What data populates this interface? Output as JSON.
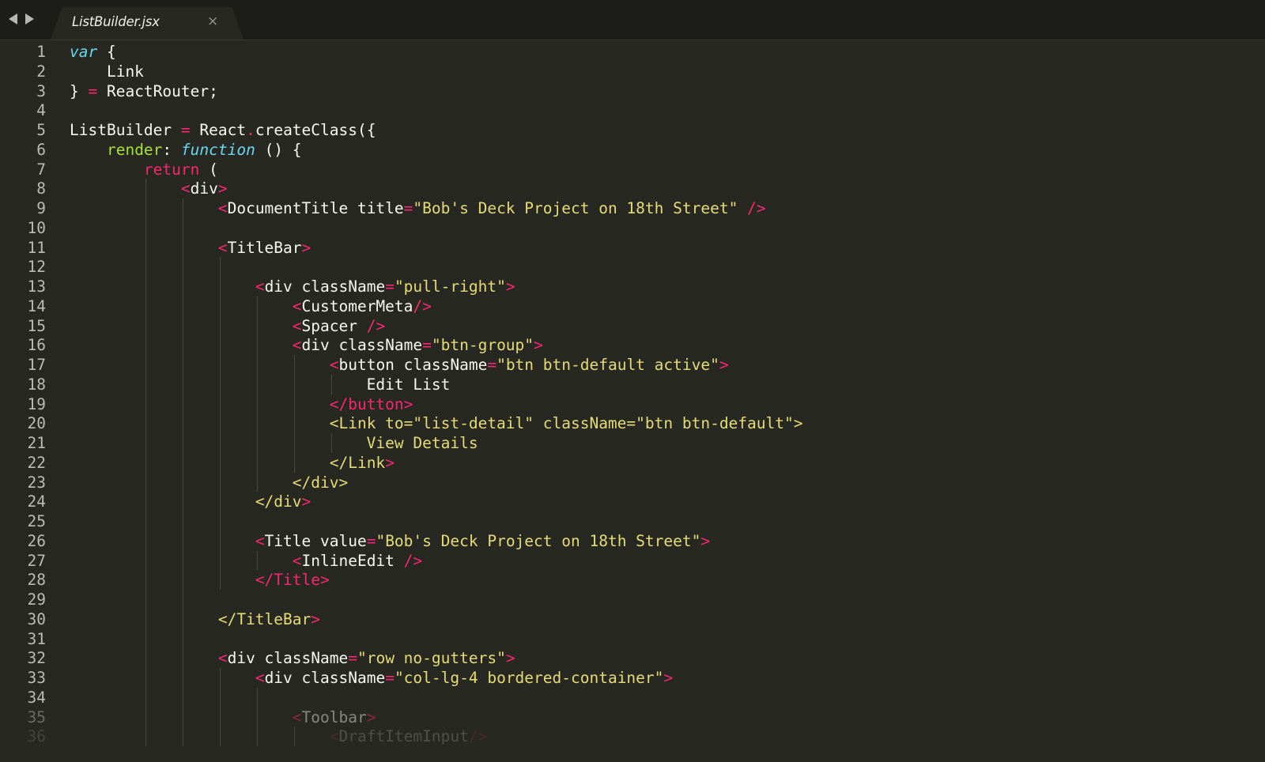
{
  "tabs": {
    "active_file": "ListBuilder.jsx",
    "close_glyph": "×"
  },
  "nav": {
    "back_icon": "arrow-left-icon",
    "forward_icon": "arrow-right-icon"
  },
  "theme": {
    "background": "#272822",
    "keyword": "#f92672",
    "storage": "#66d9ef",
    "function_name": "#a6e22e",
    "string": "#e6db74",
    "text": "#f8f8f2"
  },
  "editor": {
    "lines": [
      [
        [
          "var",
          "b"
        ],
        [
          " {",
          "w"
        ]
      ],
      [
        [
          "    Link",
          "w"
        ]
      ],
      [
        [
          "} ",
          "w"
        ],
        [
          "=",
          "p"
        ],
        [
          " ReactRouter;",
          "w"
        ]
      ],
      [],
      [
        [
          "ListBuilder ",
          "w"
        ],
        [
          "=",
          "p"
        ],
        [
          " React",
          "w"
        ],
        [
          ".",
          "p"
        ],
        [
          "createClass({",
          "w"
        ]
      ],
      [
        [
          "    ",
          "w"
        ],
        [
          "render",
          "g"
        ],
        [
          ": ",
          "w"
        ],
        [
          "function",
          "b"
        ],
        [
          " () {",
          "w"
        ]
      ],
      [
        [
          "        ",
          "w"
        ],
        [
          "return",
          "p"
        ],
        [
          " (",
          "w"
        ]
      ],
      [
        [
          "            ",
          "w"
        ],
        [
          "<",
          "p"
        ],
        [
          "div",
          "w"
        ],
        [
          ">",
          "p"
        ]
      ],
      [
        [
          "                ",
          "w"
        ],
        [
          "<",
          "p"
        ],
        [
          "DocumentTitle title",
          "w"
        ],
        [
          "=",
          "p"
        ],
        [
          "\"Bob's Deck Project on 18th Street\"",
          "y"
        ],
        [
          " />",
          "p"
        ]
      ],
      [],
      [
        [
          "                ",
          "w"
        ],
        [
          "<",
          "p"
        ],
        [
          "TitleBar",
          "w"
        ],
        [
          ">",
          "p"
        ]
      ],
      [],
      [
        [
          "                    ",
          "w"
        ],
        [
          "<",
          "p"
        ],
        [
          "div className",
          "w"
        ],
        [
          "=",
          "p"
        ],
        [
          "\"pull-right\"",
          "y"
        ],
        [
          ">",
          "p"
        ]
      ],
      [
        [
          "                        ",
          "w"
        ],
        [
          "<",
          "p"
        ],
        [
          "CustomerMeta",
          "w"
        ],
        [
          "/>",
          "p"
        ]
      ],
      [
        [
          "                        ",
          "w"
        ],
        [
          "<",
          "p"
        ],
        [
          "Spacer ",
          "w"
        ],
        [
          "/>",
          "p"
        ]
      ],
      [
        [
          "                        ",
          "w"
        ],
        [
          "<",
          "p"
        ],
        [
          "div className",
          "w"
        ],
        [
          "=",
          "p"
        ],
        [
          "\"btn-group\"",
          "y"
        ],
        [
          ">",
          "p"
        ]
      ],
      [
        [
          "                            ",
          "w"
        ],
        [
          "<",
          "p"
        ],
        [
          "button className",
          "w"
        ],
        [
          "=",
          "p"
        ],
        [
          "\"btn btn-default active\"",
          "y"
        ],
        [
          ">",
          "p"
        ]
      ],
      [
        [
          "                                Edit List",
          "w"
        ]
      ],
      [
        [
          "                            ",
          "w"
        ],
        [
          "</button>",
          "p"
        ]
      ],
      [
        [
          "                            ",
          "w"
        ],
        [
          "<Link to=\"list-detail\" className=\"btn btn-default\">",
          "y"
        ]
      ],
      [
        [
          "                                View Details",
          "y"
        ]
      ],
      [
        [
          "                            ",
          "w"
        ],
        [
          "</Link",
          "y"
        ],
        [
          ">",
          "p"
        ]
      ],
      [
        [
          "                        ",
          "w"
        ],
        [
          "</div>",
          "y"
        ]
      ],
      [
        [
          "                    ",
          "w"
        ],
        [
          "</div",
          "y"
        ],
        [
          ">",
          "p"
        ]
      ],
      [],
      [
        [
          "                    ",
          "w"
        ],
        [
          "<",
          "p"
        ],
        [
          "Title value",
          "w"
        ],
        [
          "=",
          "p"
        ],
        [
          "\"Bob's Deck Project on 18th Street\"",
          "y"
        ],
        [
          ">",
          "p"
        ]
      ],
      [
        [
          "                        ",
          "w"
        ],
        [
          "<",
          "p"
        ],
        [
          "InlineEdit ",
          "w"
        ],
        [
          "/>",
          "p"
        ]
      ],
      [
        [
          "                    ",
          "w"
        ],
        [
          "</Title>",
          "p"
        ]
      ],
      [],
      [
        [
          "                ",
          "w"
        ],
        [
          "</TitleBar",
          "y"
        ],
        [
          ">",
          "p"
        ]
      ],
      [],
      [
        [
          "                ",
          "w"
        ],
        [
          "<",
          "p"
        ],
        [
          "div className",
          "w"
        ],
        [
          "=",
          "p"
        ],
        [
          "\"row no-gutters\"",
          "y"
        ],
        [
          ">",
          "p"
        ]
      ],
      [
        [
          "                    ",
          "w"
        ],
        [
          "<",
          "p"
        ],
        [
          "div className",
          "w"
        ],
        [
          "=",
          "p"
        ],
        [
          "\"col-lg-4 bordered-container\"",
          "y"
        ],
        [
          ">",
          "p"
        ]
      ],
      [],
      [
        [
          "                        ",
          "w"
        ],
        [
          "<",
          "p"
        ],
        [
          "Toolbar",
          "w"
        ],
        [
          ">",
          "p"
        ]
      ],
      [
        [
          "                            ",
          "w"
        ],
        [
          "<",
          "p"
        ],
        [
          "DraftItemInput",
          "w"
        ],
        [
          "/>",
          "p"
        ]
      ]
    ]
  }
}
